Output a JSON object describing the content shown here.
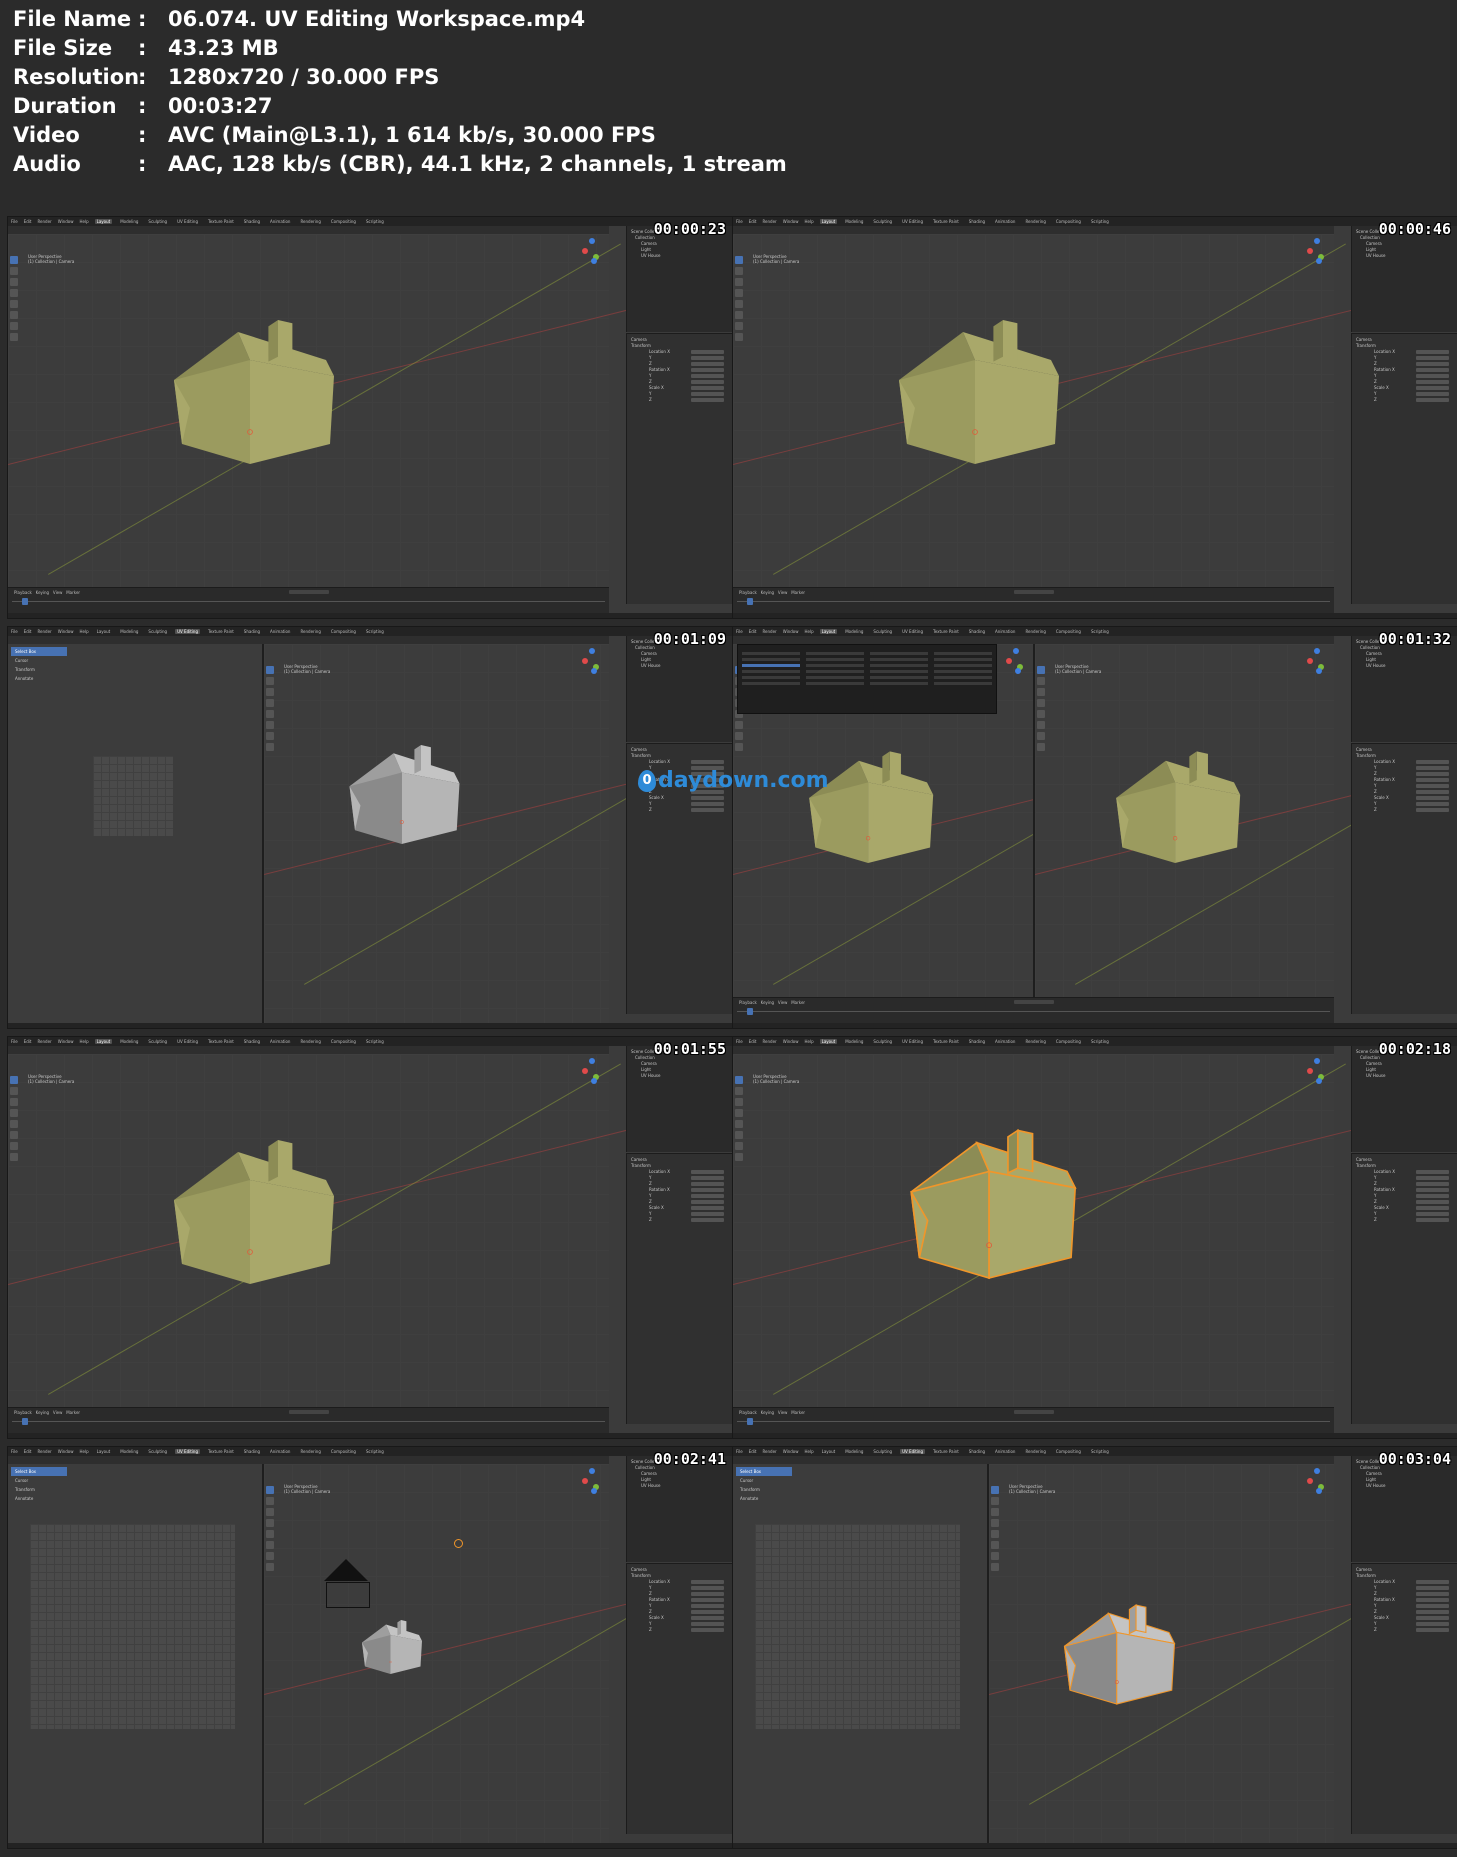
{
  "meta": {
    "rows": [
      {
        "key": "File Name",
        "value": "06.074. UV Editing Workspace.mp4"
      },
      {
        "key": "File Size",
        "value": "43.23 MB"
      },
      {
        "key": "Resolution",
        "value": "1280x720 / 30.000 FPS"
      },
      {
        "key": "Duration",
        "value": "00:03:27"
      },
      {
        "key": "Video",
        "value": "AVC (Main@L3.1), 1 614 kb/s, 30.000 FPS"
      },
      {
        "key": "Audio",
        "value": "AAC, 128 kb/s (CBR), 44.1 kHz, 2 channels, 1 stream"
      }
    ],
    "separator": ":"
  },
  "thumbnails": [
    {
      "timestamp": "00:00:23",
      "mode": "layout",
      "house": "green"
    },
    {
      "timestamp": "00:00:46",
      "mode": "layout",
      "house": "green"
    },
    {
      "timestamp": "00:01:09",
      "mode": "uv",
      "house": "grey"
    },
    {
      "timestamp": "00:01:32",
      "mode": "split",
      "house": "green"
    },
    {
      "timestamp": "00:01:55",
      "mode": "layout",
      "house": "green"
    },
    {
      "timestamp": "00:02:18",
      "mode": "layout-selected",
      "house": "green"
    },
    {
      "timestamp": "00:02:41",
      "mode": "uv-light",
      "house": "grey"
    },
    {
      "timestamp": "00:03:04",
      "mode": "uv-selected",
      "house": "grey"
    }
  ],
  "blender_ui": {
    "menus": [
      "File",
      "Edit",
      "Render",
      "Window",
      "Help"
    ],
    "workspace_tabs": [
      "Layout",
      "Modeling",
      "Sculpting",
      "UV Editing",
      "Texture Paint",
      "Shading",
      "Animation",
      "Rendering",
      "Compositing",
      "Scripting"
    ],
    "viewport_label_1": "User Perspective",
    "viewport_label_2": "(1) Collection | Camera",
    "outliner_title": "Scene Collection",
    "outliner_items": [
      "Collection",
      "Camera",
      "Light",
      "UV House"
    ],
    "props_title": "Camera",
    "props_section": "Transform",
    "props_rows": [
      "Location X",
      "Y",
      "Z",
      "Rotation X",
      "Y",
      "Z",
      "Scale X",
      "Y",
      "Z"
    ],
    "uv_tools": [
      "Select Box",
      "Cursor",
      "Transform",
      "Annotate"
    ],
    "timeline_menu": "Playback   Keying   View   Marker"
  },
  "watermark": {
    "glyph": "0",
    "text": "daydown.com"
  },
  "colors": {
    "house_green": "#a9a86a",
    "house_green_dark": "#8c8c55",
    "house_green_side": "#9b9b5f",
    "house_grey": "#b5b5b5",
    "house_grey_dark": "#8a8a8a",
    "select_orange": "#f0962a",
    "blender_blue": "#4772b3"
  }
}
